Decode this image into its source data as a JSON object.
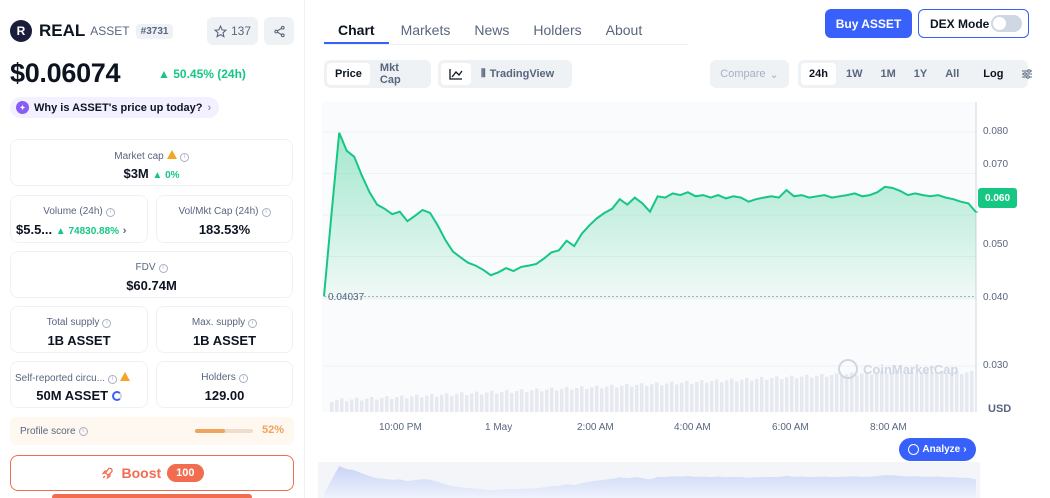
{
  "coin": {
    "name": "REAL",
    "symbol": "ASSET",
    "rank": "#3731",
    "watchlist_count": "137",
    "price": "$0.06074",
    "change_24h": "50.45% (24h)",
    "why_label": "Why is ASSET's price up today?"
  },
  "stats": {
    "market_cap": {
      "label": "Market cap",
      "value": "$3M",
      "change": "0%"
    },
    "volume": {
      "label": "Volume (24h)",
      "value": "$5.5...",
      "change": "74830.88%"
    },
    "vol_mkt_cap": {
      "label": "Vol/Mkt Cap (24h)",
      "value": "183.53%"
    },
    "fdv": {
      "label": "FDV",
      "value": "$60.74M"
    },
    "total_supply": {
      "label": "Total supply",
      "value": "1B ASSET"
    },
    "max_supply": {
      "label": "Max. supply",
      "value": "1B ASSET"
    },
    "self_reported": {
      "label": "Self-reported circu...",
      "value": "50M ASSET"
    },
    "holders": {
      "label": "Holders",
      "value": "129.00"
    }
  },
  "profile": {
    "label": "Profile score",
    "value": "52%",
    "fill": 0.52
  },
  "boost": {
    "label": "Boost",
    "count": "100"
  },
  "tabs": [
    "Chart",
    "Markets",
    "News",
    "Holders",
    "About"
  ],
  "actions": {
    "buy": "Buy ASSET",
    "dex_mode": "DEX Mode"
  },
  "chart_toolbar": {
    "price": "Price",
    "mkt_cap": "Mkt Cap",
    "tradingview": "TradingView",
    "compare": "Compare",
    "ranges": [
      "24h",
      "1W",
      "1M",
      "1Y",
      "All"
    ],
    "log": "Log"
  },
  "chart_meta": {
    "current_tag": "0.060",
    "low_label": "0.04037",
    "currency": "USD",
    "watermark": "CoinMarketCap",
    "analyze": "Analyze"
  },
  "colors": {
    "up": "#16c784",
    "accent": "#3861fb",
    "boost": "#f26c4f"
  },
  "chart_data": {
    "type": "area",
    "ylim": [
      0.03,
      0.082
    ],
    "y_ticks": [
      "0.080",
      "0.070",
      "0.050",
      "0.040",
      "0.030"
    ],
    "x_ticks": [
      "10:00 PM",
      "1 May",
      "2:00 AM",
      "4:00 AM",
      "6:00 AM",
      "8:00 AM"
    ],
    "series": [
      {
        "values": [
          0.0404,
          0.0605,
          0.0798,
          0.0755,
          0.074,
          0.0695,
          0.0655,
          0.0625,
          0.0615,
          0.0602,
          0.0608,
          0.0585,
          0.0598,
          0.0612,
          0.0605,
          0.0575,
          0.054,
          0.0512,
          0.0498,
          0.0485,
          0.0478,
          0.0468,
          0.0455,
          0.0462,
          0.0472,
          0.0465,
          0.0475,
          0.0478,
          0.0482,
          0.0495,
          0.051,
          0.0515,
          0.0538,
          0.0525,
          0.0555,
          0.0575,
          0.0592,
          0.0605,
          0.0615,
          0.0638,
          0.0625,
          0.0642,
          0.0628,
          0.0608,
          0.0645,
          0.0642,
          0.0652,
          0.0648,
          0.0655,
          0.0645,
          0.0648,
          0.0642,
          0.0648,
          0.064,
          0.0645,
          0.0642,
          0.0632,
          0.0638,
          0.0642,
          0.0645,
          0.0642,
          0.066,
          0.0645,
          0.0648,
          0.0642,
          0.0645,
          0.0648,
          0.0642,
          0.0645,
          0.0648,
          0.0652,
          0.0645,
          0.0648,
          0.0655,
          0.0668,
          0.0665,
          0.0658,
          0.0648,
          0.0652,
          0.0648,
          0.0645,
          0.0648,
          0.0642,
          0.0638,
          0.0632,
          0.0628,
          0.0607
        ]
      }
    ]
  }
}
